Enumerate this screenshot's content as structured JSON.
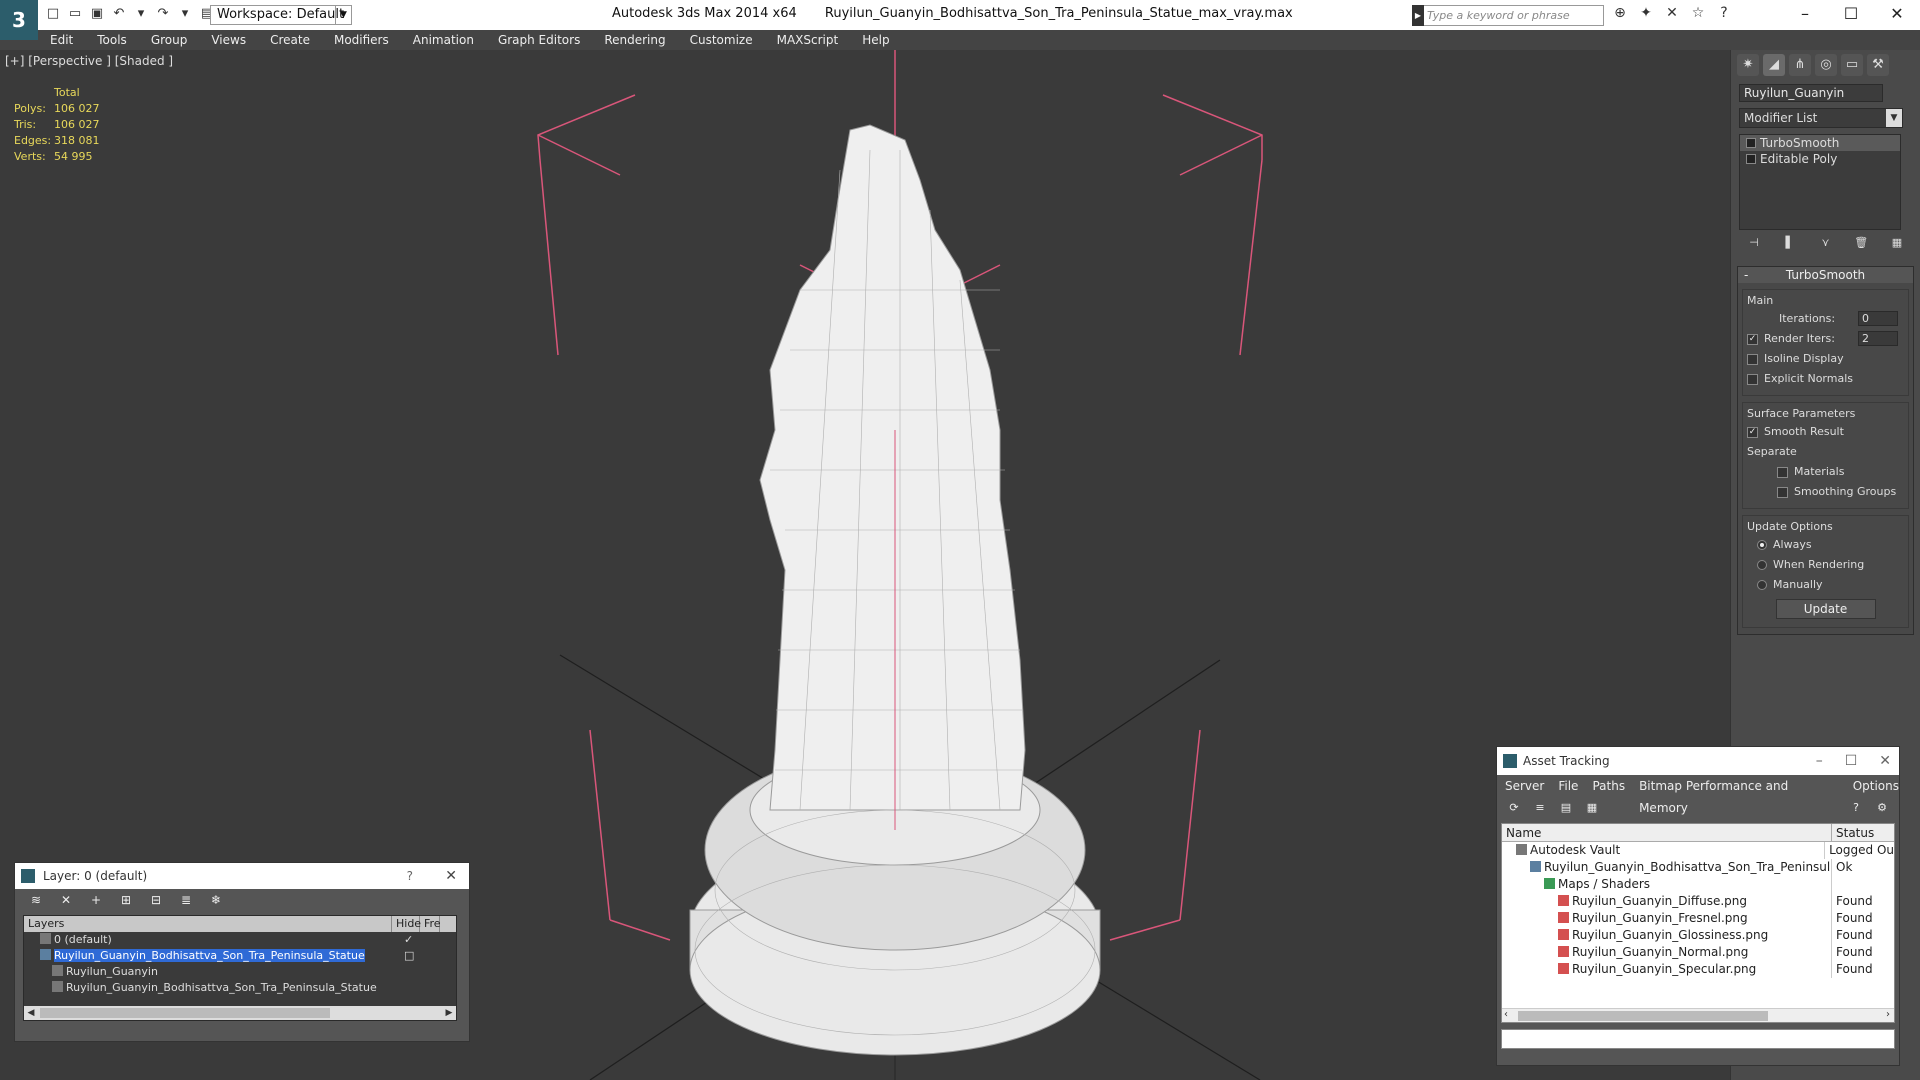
{
  "title": {
    "app": "Autodesk 3ds Max  2014 x64",
    "file": "Ruyilun_Guanyin_Bodhisattva_Son_Tra_Peninsula_Statue_max_vray.max",
    "logo": "3",
    "workspace": "Workspace: Default",
    "search_placeholder": "Type a keyword or phrase"
  },
  "menu": [
    "Edit",
    "Tools",
    "Group",
    "Views",
    "Create",
    "Modifiers",
    "Animation",
    "Graph Editors",
    "Rendering",
    "Customize",
    "MAXScript",
    "Help"
  ],
  "viewport": {
    "label": "[+] [Perspective ] [Shaded ]",
    "stats": {
      "header": "Total",
      "rows": [
        {
          "k": "Polys:",
          "v": "106 027"
        },
        {
          "k": "Tris:",
          "v": "106 027"
        },
        {
          "k": "Edges:",
          "v": "318 081"
        },
        {
          "k": "Verts:",
          "v": "54 995"
        }
      ]
    }
  },
  "command_panel": {
    "object_name": "Ruyilun_Guanyin",
    "modifier_list": "Modifier List",
    "stack": [
      "TurboSmooth",
      "Editable Poly"
    ],
    "rollout_title": "TurboSmooth",
    "main": {
      "label": "Main",
      "iterations_label": "Iterations:",
      "iterations_value": "0",
      "render_iters_label": "Render Iters:",
      "render_iters_value": "2",
      "isoline": "Isoline Display",
      "explicit": "Explicit Normals"
    },
    "surface": {
      "label": "Surface Parameters",
      "smooth": "Smooth Result",
      "separate": "Separate",
      "materials": "Materials",
      "smoothing_groups": "Smoothing Groups"
    },
    "update": {
      "label": "Update Options",
      "always": "Always",
      "when_rendering": "When Rendering",
      "manually": "Manually",
      "button": "Update"
    }
  },
  "layer_window": {
    "title": "Layer: 0 (default)",
    "help": "?",
    "columns": {
      "layers": "Layers",
      "hide": "Hide",
      "freeze": "Fre"
    },
    "rows": [
      {
        "name": "0 (default)",
        "indent": 16
      },
      {
        "name": "Ruyilun_Guanyin_Bodhisattva_Son_Tra_Peninsula_Statue",
        "indent": 16
      },
      {
        "name": "Ruyilun_Guanyin",
        "indent": 28
      },
      {
        "name": "Ruyilun_Guanyin_Bodhisattva_Son_Tra_Peninsula_Statue",
        "indent": 28
      }
    ]
  },
  "asset_window": {
    "title": "Asset Tracking",
    "menu": [
      "Server",
      "File",
      "Paths",
      "Bitmap Performance and Memory",
      "Options"
    ],
    "columns": {
      "name": "Name",
      "status": "Status"
    },
    "rows": [
      {
        "name": "Autodesk Vault",
        "status": "Logged Ou",
        "icon": "vault",
        "indent": 14
      },
      {
        "name": "Ruyilun_Guanyin_Bodhisattva_Son_Tra_Peninsula_...",
        "status": "Ok",
        "icon": "file",
        "indent": 28
      },
      {
        "name": "Maps / Shaders",
        "status": "",
        "icon": "maps",
        "indent": 42
      },
      {
        "name": "Ruyilun_Guanyin_Diffuse.png",
        "status": "Found",
        "icon": "png",
        "indent": 56
      },
      {
        "name": "Ruyilun_Guanyin_Fresnel.png",
        "status": "Found",
        "icon": "png",
        "indent": 56
      },
      {
        "name": "Ruyilun_Guanyin_Glossiness.png",
        "status": "Found",
        "icon": "png",
        "indent": 56
      },
      {
        "name": "Ruyilun_Guanyin_Normal.png",
        "status": "Found",
        "icon": "png",
        "indent": 56
      },
      {
        "name": "Ruyilun_Guanyin_Specular.png",
        "status": "Found",
        "icon": "png",
        "indent": 56
      }
    ]
  }
}
